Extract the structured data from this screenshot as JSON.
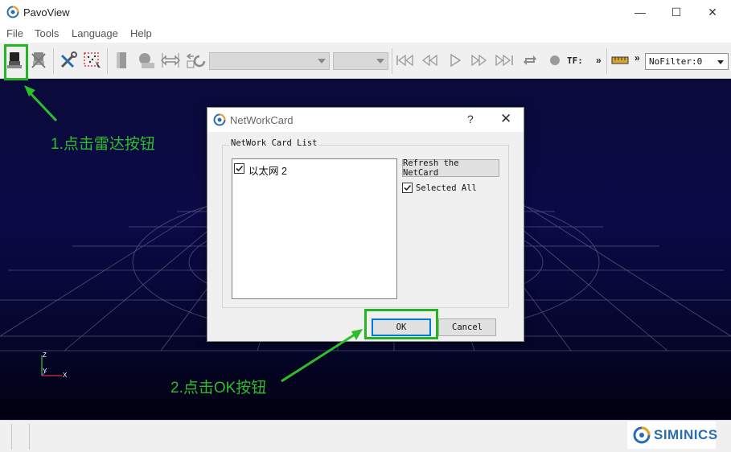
{
  "window": {
    "title": "PavoView",
    "controls": {
      "minimize": "—",
      "maximize": "☐",
      "close": "✕"
    }
  },
  "menu": [
    "File",
    "Tools",
    "Language",
    "Help"
  ],
  "toolbar": {
    "tf_label": "TF:",
    "overflow_1": "»",
    "overflow_2": "»",
    "filter_value": "NoFilter:0",
    "icons": [
      "connect-lidar-icon",
      "disconnect-lidar-icon",
      "tools-icon",
      "select-region-icon",
      "box-icon",
      "sphere-icon",
      "measure-icon",
      "rotate-icon",
      "first-frame-icon",
      "prev-frame-icon",
      "play-icon",
      "next-frame-icon",
      "last-frame-icon",
      "loop-icon",
      "record-icon",
      "ruler-icon"
    ]
  },
  "viewport": {
    "axis_labels": {
      "z": "Z",
      "y": "Y",
      "x": "X"
    },
    "accent": "#22b422"
  },
  "dialog": {
    "title": "NetWorkCard",
    "help": "?",
    "close": "✕",
    "group_title": "NetWork Card List",
    "cards": [
      {
        "label": "以太网 2",
        "checked": true
      }
    ],
    "refresh_button": "Refresh the NetCard",
    "selected_all_label": "Selected All",
    "selected_all_checked": true,
    "ok_button": "OK",
    "cancel_button": "Cancel"
  },
  "annotations": {
    "step1": "1.点击雷达按钮",
    "step2": "2.点击OK按钮"
  },
  "brand": {
    "name": "SIMINICS"
  }
}
